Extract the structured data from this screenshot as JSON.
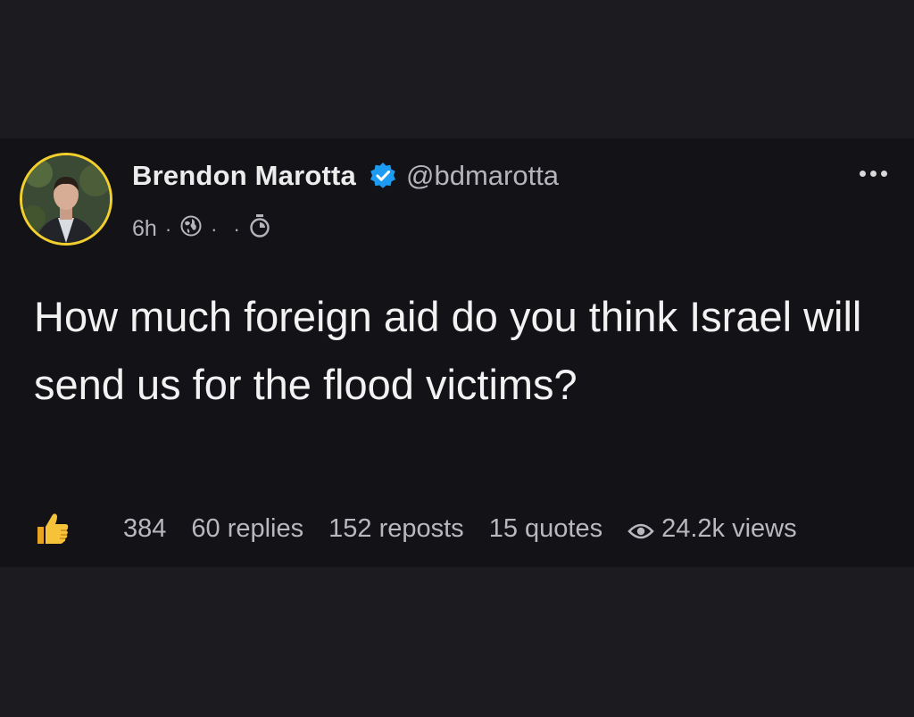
{
  "post": {
    "author_name": "Brendon Marotta",
    "author_handle": "@bdmarotta",
    "time": "6h",
    "meta_sep": "·",
    "text": "How much foreign aid do you think Israel will send us for the flood victims?",
    "stats": {
      "likes": "384",
      "replies": "60 replies",
      "reposts": "152 reposts",
      "quotes": "15 quotes",
      "views": "24.2k views"
    }
  },
  "colors": {
    "background": "#1c1c20",
    "card": "#121217",
    "verified_badge": "#1d9bf0",
    "avatar_ring": "#f2cf2d"
  },
  "icons": [
    "verified-badge-icon",
    "globe-icon",
    "timer-icon",
    "more-options-icon",
    "thumbs-up-icon",
    "eye-icon"
  ]
}
